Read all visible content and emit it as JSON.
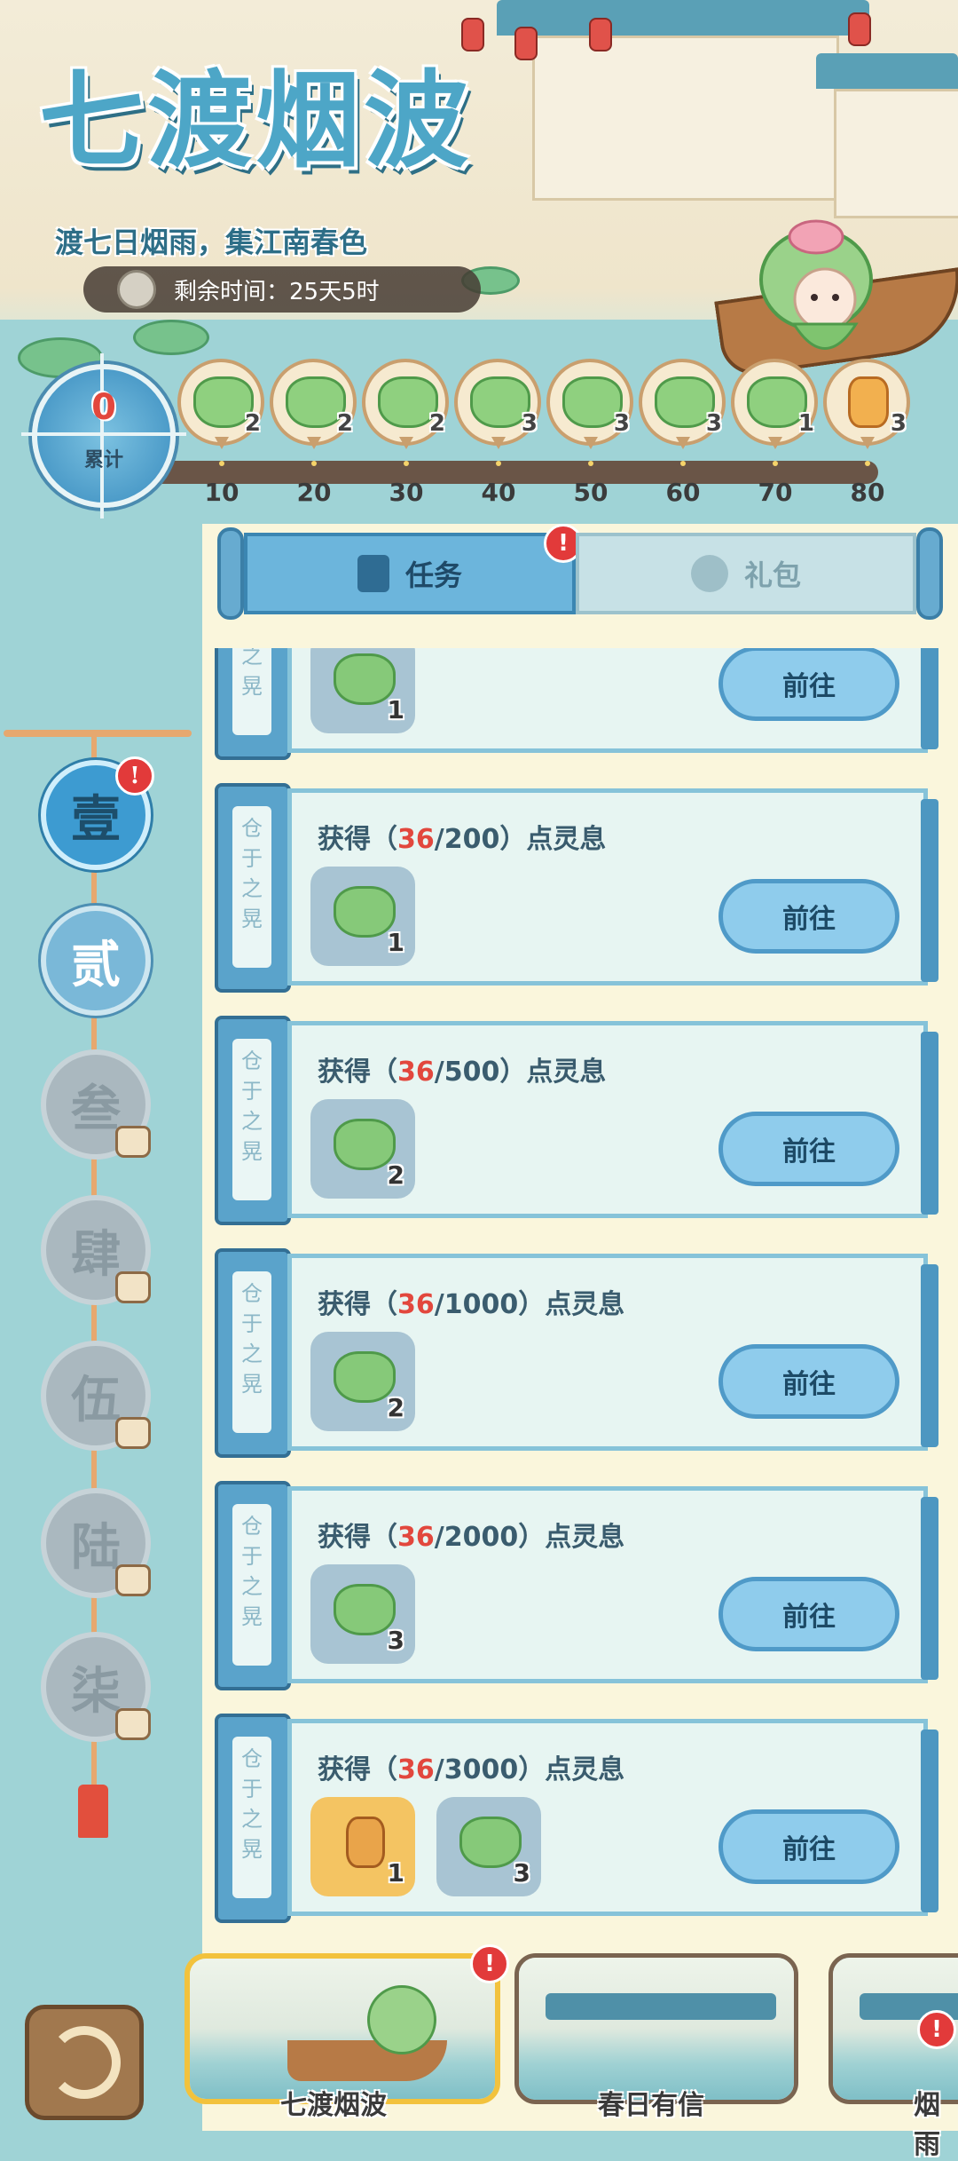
{
  "event": {
    "title": "七渡烟波",
    "subtitle": "渡七日烟雨，集江南春色",
    "timer_label": "剩余时间：",
    "timer_value": "25天5时"
  },
  "progress": {
    "total_value": "0",
    "total_label": "累计",
    "milestones": [
      {
        "threshold": "10",
        "reward_icon": "lotus-spirit-icon",
        "count": "2"
      },
      {
        "threshold": "20",
        "reward_icon": "lotus-spirit-icon",
        "count": "2"
      },
      {
        "threshold": "30",
        "reward_icon": "lotus-spirit-icon",
        "count": "2"
      },
      {
        "threshold": "40",
        "reward_icon": "lotus-spirit-icon",
        "count": "3"
      },
      {
        "threshold": "50",
        "reward_icon": "lotus-spirit-icon",
        "count": "3"
      },
      {
        "threshold": "60",
        "reward_icon": "lotus-spirit-icon",
        "count": "3"
      },
      {
        "threshold": "70",
        "reward_icon": "lotus-spirit-large-icon",
        "count": "1"
      },
      {
        "threshold": "80",
        "reward_icon": "gourd-icon",
        "count": "3"
      }
    ]
  },
  "tabs": {
    "tasks": "任务",
    "gifts": "礼包",
    "tasks_badge": "!"
  },
  "side_nav": [
    {
      "label": "壹",
      "state": "active",
      "badge": "!"
    },
    {
      "label": "贰",
      "state": "open"
    },
    {
      "label": "叁",
      "state": "locked"
    },
    {
      "label": "肆",
      "state": "locked"
    },
    {
      "label": "伍",
      "state": "locked"
    },
    {
      "label": "陆",
      "state": "locked"
    },
    {
      "label": "柒",
      "state": "locked"
    }
  ],
  "tasks": [
    {
      "prefix": "",
      "current": "",
      "target": "",
      "suffix": "",
      "rewards": [
        {
          "icon": "lotus-spirit-icon",
          "count": "1",
          "style": "blue"
        }
      ],
      "button": "前往"
    },
    {
      "prefix": "获得（",
      "current": "36",
      "target": "/200）",
      "suffix": "点灵息",
      "rewards": [
        {
          "icon": "lotus-spirit-icon",
          "count": "1",
          "style": "blue"
        }
      ],
      "button": "前往"
    },
    {
      "prefix": "获得（",
      "current": "36",
      "target": "/500）",
      "suffix": "点灵息",
      "rewards": [
        {
          "icon": "lotus-spirit-icon",
          "count": "2",
          "style": "blue"
        }
      ],
      "button": "前往"
    },
    {
      "prefix": "获得（",
      "current": "36",
      "target": "/1000）",
      "suffix": "点灵息",
      "rewards": [
        {
          "icon": "lotus-spirit-icon",
          "count": "2",
          "style": "blue"
        }
      ],
      "button": "前往"
    },
    {
      "prefix": "获得（",
      "current": "36",
      "target": "/2000）",
      "suffix": "点灵息",
      "rewards": [
        {
          "icon": "lotus-spirit-icon",
          "count": "3",
          "style": "blue"
        }
      ],
      "button": "前往"
    },
    {
      "prefix": "获得（",
      "current": "36",
      "target": "/3000）",
      "suffix": "点灵息",
      "rewards": [
        {
          "icon": "gourd-icon",
          "count": "1",
          "style": "gold"
        },
        {
          "icon": "lotus-spirit-icon",
          "count": "3",
          "style": "blue"
        }
      ],
      "button": "前往"
    }
  ],
  "task_spine_label": "仓于之晃",
  "events_strip": [
    {
      "label": "七渡烟波",
      "selected": true,
      "badge": "!"
    },
    {
      "label": "春日有信",
      "selected": false
    },
    {
      "label": "烟雨",
      "selected": false,
      "badge": "!"
    }
  ],
  "colors": {
    "accent_blue": "#4da6c7",
    "highlight_red": "#e2473d",
    "panel_cream": "#faf6dc",
    "side_teal": "#9fd3d6"
  }
}
